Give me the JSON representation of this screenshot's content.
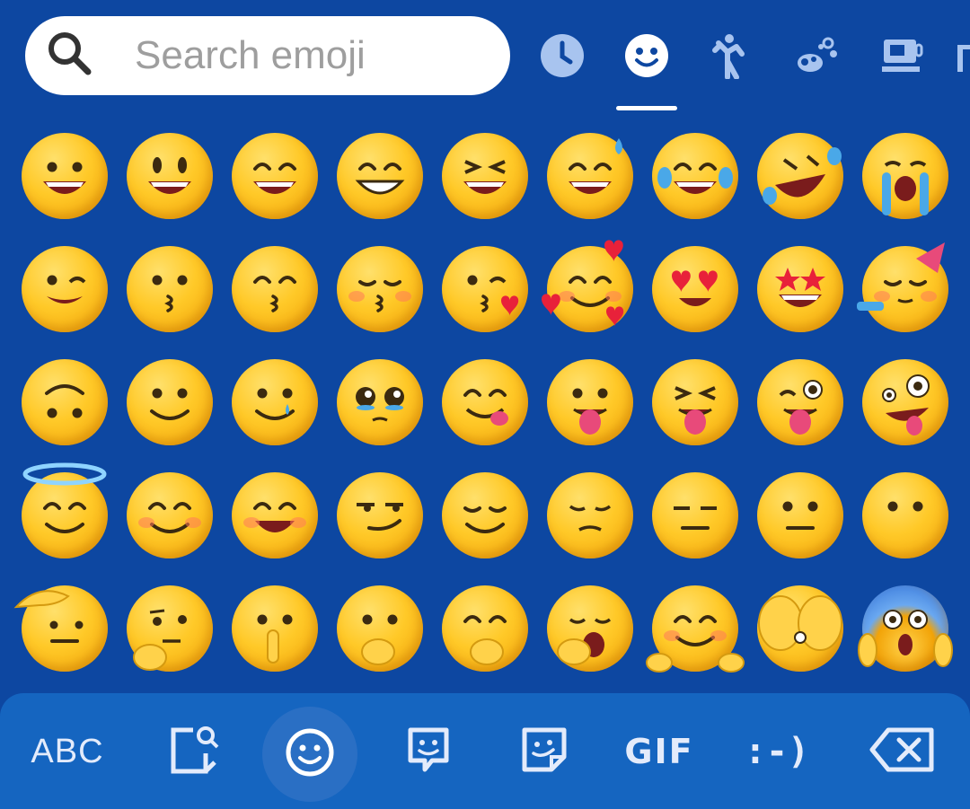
{
  "search": {
    "placeholder": "Search emoji"
  },
  "categories": [
    {
      "icon": "clock-icon",
      "label": "recent"
    },
    {
      "icon": "smiley-icon",
      "label": "smileys",
      "active": true
    },
    {
      "icon": "person-icon",
      "label": "people"
    },
    {
      "icon": "nature-icon",
      "label": "animals"
    },
    {
      "icon": "food-icon",
      "label": "food"
    },
    {
      "icon": "more-icon",
      "label": "more"
    }
  ],
  "emoji_rows": [
    [
      "grinning-face",
      "grinning-face-big-eyes",
      "grinning-smiling-eyes",
      "beaming-face",
      "squinting-laughing",
      "grinning-sweat",
      "tears-of-joy",
      "rolling-laughing",
      "loudly-crying"
    ],
    [
      "winking-face",
      "kissing-face",
      "kissing-smiling-eyes",
      "kissing-closed-eyes",
      "face-blowing-kiss",
      "smiling-hearts",
      "heart-eyes",
      "star-struck",
      "partying-face"
    ],
    [
      "upside-down-face",
      "slightly-smiling",
      "face-holding-tears",
      "pleading-face",
      "face-savoring-food",
      "face-with-tongue",
      "squinting-tongue",
      "winking-tongue",
      "zany-face"
    ],
    [
      "smiling-halo",
      "smiling-blush",
      "relieved-face",
      "smirking-face",
      "relieved-closed-eyes",
      "pensive-face",
      "expressionless-face",
      "neutral-face",
      "face-without-mouth"
    ],
    [
      "saluting-face",
      "thinking-face",
      "shushing-face",
      "hand-over-mouth",
      "open-eyes-hand-mouth",
      "yawning-face",
      "hugging-face",
      "hiding-face",
      "screaming-in-fear"
    ]
  ],
  "bottom_bar": {
    "abc_label": "ABC",
    "gif_label": "GIF",
    "emoticon_label": ":-)",
    "icons": [
      "sticker-search-icon",
      "emoji-icon",
      "bitmoji-icon",
      "sticker-icon",
      "backspace-icon"
    ]
  },
  "colors": {
    "background": "#0d47a1",
    "bottom_bar": "#1565c0",
    "emoji_yellow": "#ffc928",
    "accent": "#ffffff"
  }
}
